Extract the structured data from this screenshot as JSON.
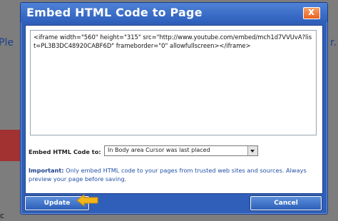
{
  "background": {
    "left_text": "Ple",
    "right_text": "r.",
    "bottom_text": "c"
  },
  "dialog": {
    "title": "Embed HTML Code to Page",
    "close_label": "x",
    "code": "<iframe width=\"560\" height=\"315\" src=\"http://www.youtube.com/embed/mch1d7VVUvA?list=PL3B3DC48920CABF6D\" frameborder=\"0\" allowfullscreen></iframe>",
    "embed_label": "Embed HTML Code to:",
    "embed_selected": "In Body area Cursor was last placed",
    "note_bold": "Important:",
    "note_text": " Only embed HTML code to your pages from trusted web sites and sources. Always preview your page before saving.",
    "update_label": "Update",
    "cancel_label": "Cancel"
  },
  "colors": {
    "dialog_blue": "#2f5fb8",
    "close_orange": "#e8611e",
    "arrow_yellow": "#f2b51b"
  }
}
